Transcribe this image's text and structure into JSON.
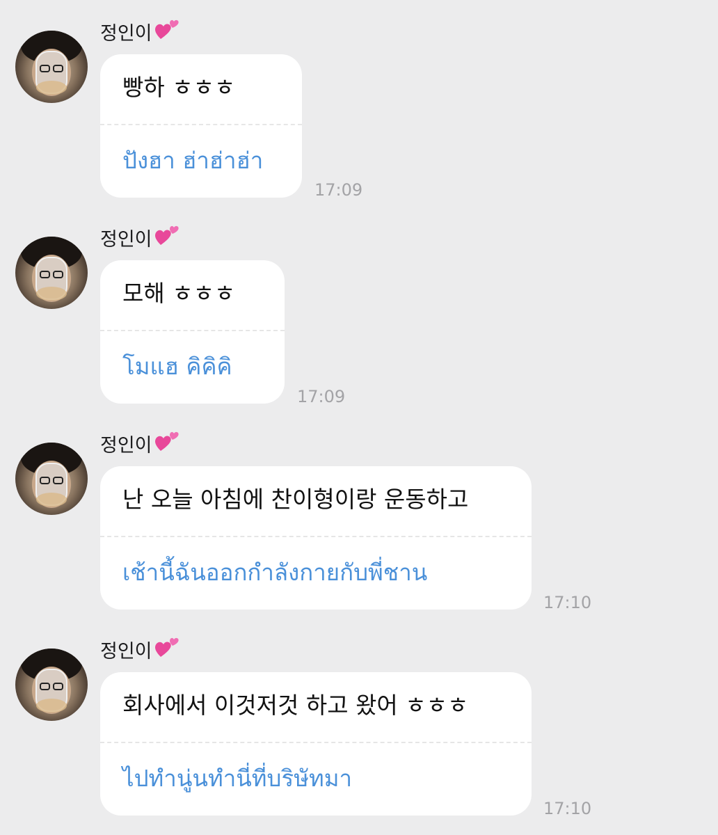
{
  "messages": [
    {
      "sender": "정인이",
      "original": "빵하 ㅎㅎㅎ",
      "translation": "ปังฮา ฮ่าฮ่าฮ่า",
      "time": "17:09"
    },
    {
      "sender": "정인이",
      "original": "모해 ㅎㅎㅎ",
      "translation": "โมแฮ คิคิคิ",
      "time": "17:09"
    },
    {
      "sender": "정인이",
      "original": "난 오늘 아침에 찬이형이랑 운동하고",
      "translation": "เช้านี้ฉันออกกำลังกายกับพี่ชาน",
      "time": "17:10"
    },
    {
      "sender": "정인이",
      "original": "회사에서 이것저것 하고 왔어 ㅎㅎㅎ",
      "translation": "ไปทำนู่นทำนี่ที่บริษัทมา",
      "time": "17:10"
    }
  ],
  "colors": {
    "background": "#ececed",
    "bubble": "#ffffff",
    "translation_text": "#4a90d9",
    "timestamp": "#a3a3a6",
    "heart": "#e8489a"
  },
  "icons": {
    "sender_suffix": "two-hearts-icon"
  }
}
